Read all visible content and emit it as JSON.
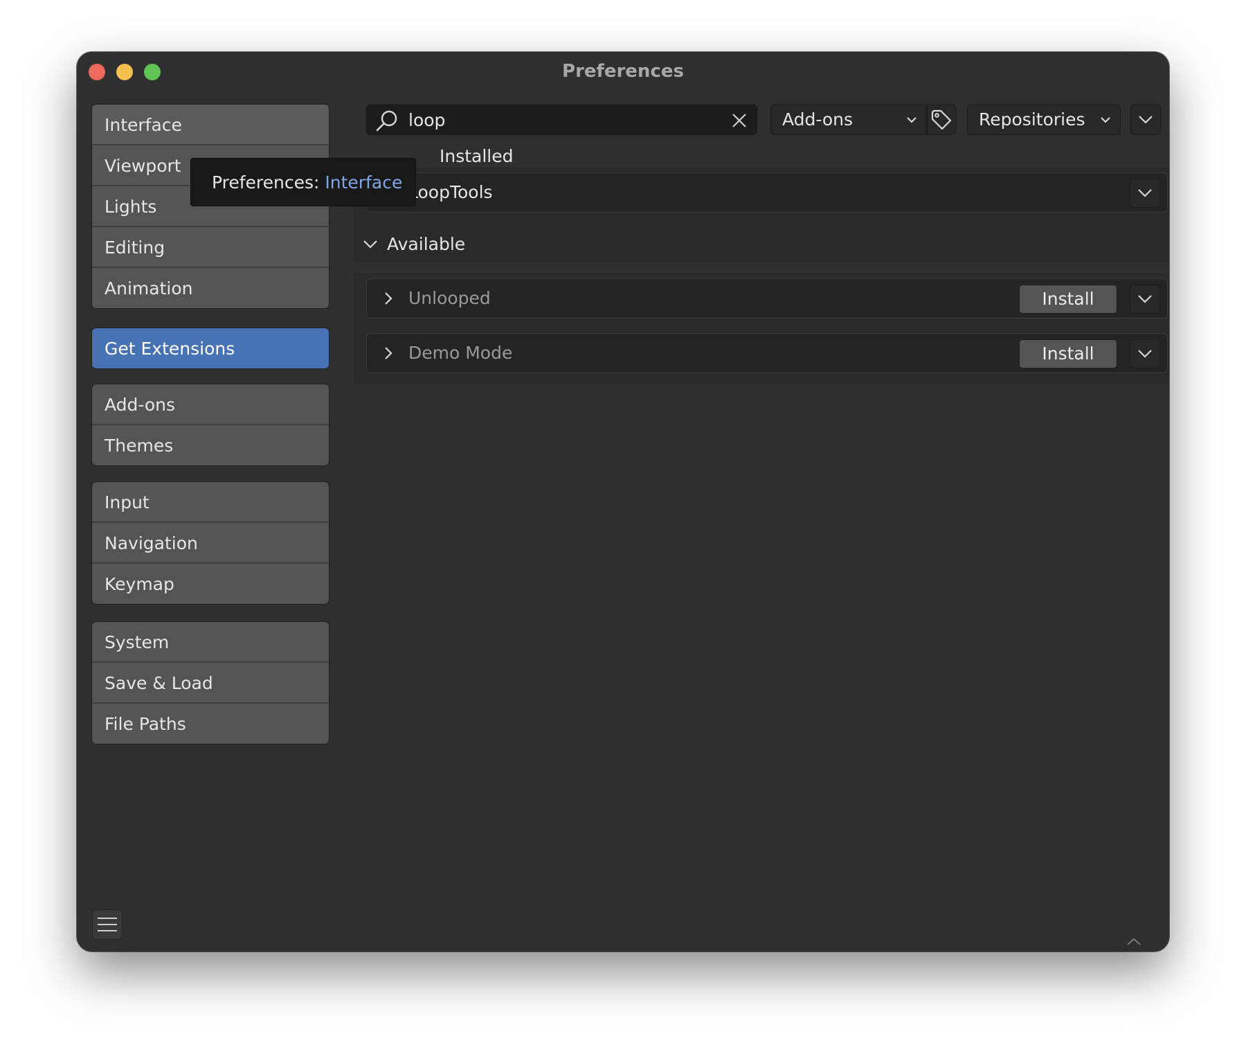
{
  "window": {
    "title": "Preferences"
  },
  "sidebar": {
    "groups": [
      [
        "Interface",
        "Viewport",
        "Lights",
        "Editing",
        "Animation"
      ],
      [
        "Get Extensions"
      ],
      [
        "Add-ons",
        "Themes"
      ],
      [
        "Input",
        "Navigation",
        "Keymap"
      ],
      [
        "System",
        "Save & Load",
        "File Paths"
      ]
    ]
  },
  "toolbar": {
    "search_value": "loop",
    "type_filter": "Add-ons",
    "repo_filter": "Repositories"
  },
  "sections": {
    "installed_label": "Installed",
    "available_label": "Available"
  },
  "extensions": {
    "installed": [
      {
        "name": "LoopTools"
      }
    ],
    "available": [
      {
        "name": "Unlooped",
        "action": "Install"
      },
      {
        "name": "Demo Mode",
        "action": "Install"
      }
    ]
  },
  "tooltip": {
    "prefix": "Preferences: ",
    "highlight": "Interface"
  },
  "colors": {
    "accent": "#4772b3",
    "window_bg": "#2f2f2f",
    "button_bg": "#545454",
    "tooltip_highlight": "#7fa6e6"
  }
}
